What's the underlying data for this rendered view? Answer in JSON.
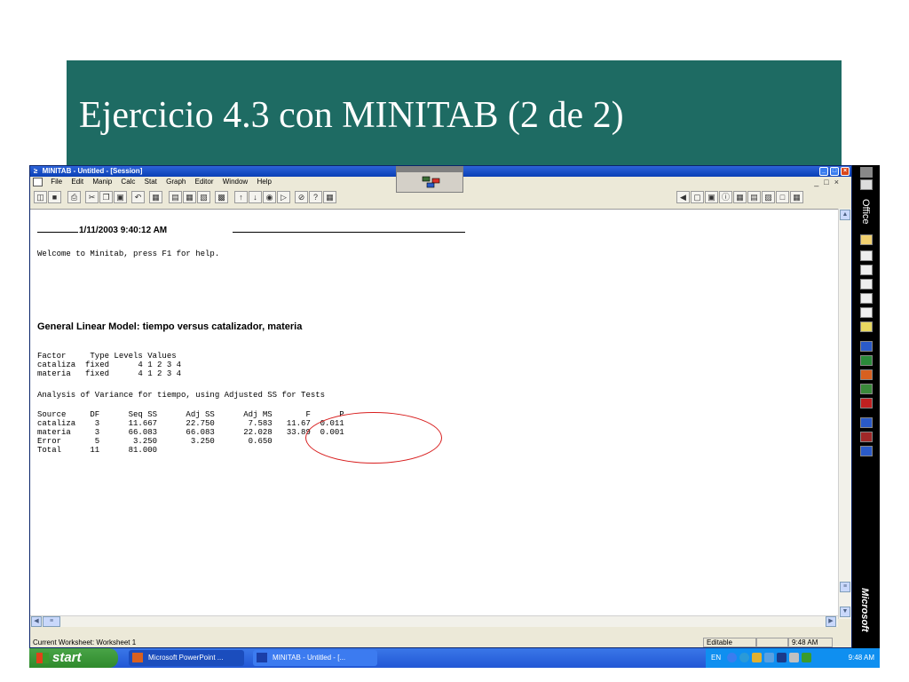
{
  "slide": {
    "title": "Ejercicio 4.3 con MINITAB (2 de 2)"
  },
  "window": {
    "title": "MINITAB - Untitled - [Session]",
    "menu": [
      "File",
      "Edit",
      "Manip",
      "Calc",
      "Stat",
      "Graph",
      "Editor",
      "Window",
      "Help"
    ]
  },
  "session": {
    "timestamp": "1/11/2003 9:40:12 AM",
    "welcome": "Welcome to Minitab, press F1 for help.",
    "glm_title": "General Linear Model: tiempo versus catalizador, materia",
    "factor_table": "Factor     Type Levels Values\ncataliza  fixed      4 1 2 3 4\nmateria   fixed      4 1 2 3 4",
    "anova_title": "Analysis of Variance for tiempo, using Adjusted SS for Tests",
    "anova_table": "Source     DF      Seq SS      Adj SS      Adj MS       F      P\ncataliza    3      11.667      22.750       7.583   11.67  0.011\nmateria     3      66.083      66.083      22.028   33.89  0.001\nError       5       3.250       3.250       0.650\nTotal      11      81.000"
  },
  "statusbar": {
    "worksheet": "Current Worksheet: Worksheet 1",
    "mode": "Editable",
    "time": "9:48 AM"
  },
  "office_bar": {
    "label": "Office",
    "brand": "Microsoft"
  },
  "taskbar": {
    "start": "start",
    "tasks": [
      "Microsoft PowerPoint ...",
      "MINITAB - Untitled - [..."
    ],
    "lang": "EN",
    "clock": "9:48 AM"
  },
  "colors": {
    "title_band": "#1e6b63",
    "highlight_circle": "#d81e1e",
    "taskbar": "#2257d5",
    "start": "#3a9b2c"
  }
}
